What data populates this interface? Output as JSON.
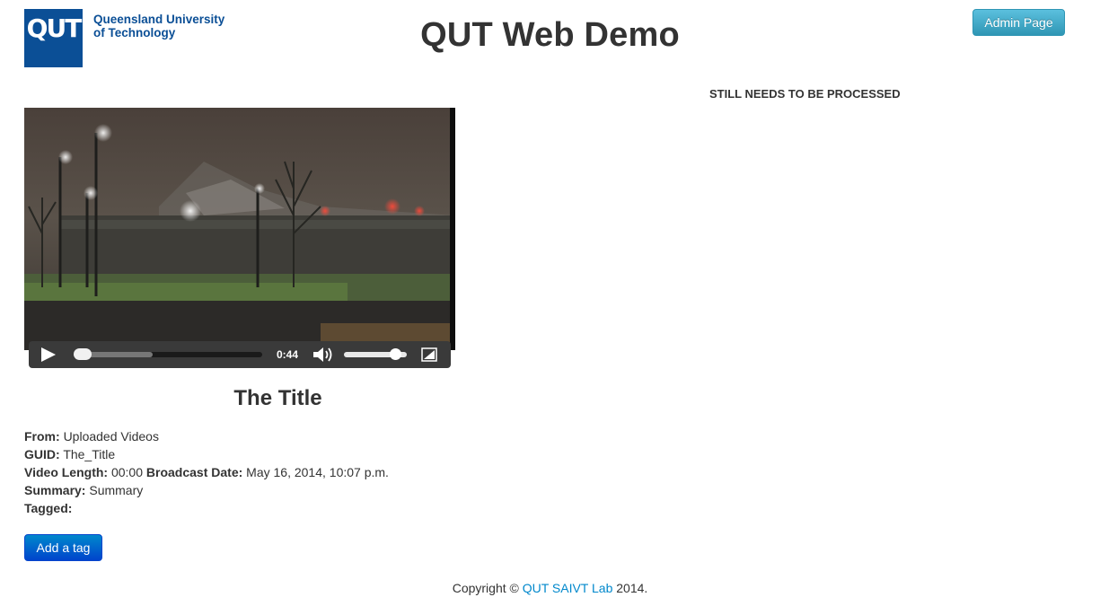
{
  "header": {
    "logo_mark": "QUT",
    "logo_line1": "Queensland University",
    "logo_line2": "of Technology",
    "title": "QUT Web Demo",
    "admin_label": "Admin Page"
  },
  "status_message": "STILL NEEDS TO BE PROCESSED",
  "player": {
    "time": "0:44",
    "progress_fraction": 0.02,
    "buffered_fraction": 0.42,
    "volume_fraction": 0.9
  },
  "video": {
    "title": "The Title",
    "from_label": "From:",
    "from_value": "Uploaded Videos",
    "guid_label": "GUID:",
    "guid_value": "The_Title",
    "length_label": "Video Length:",
    "length_value": "00:00",
    "broadcast_label": "Broadcast Date:",
    "broadcast_value": "May 16, 2014, 10:07 p.m.",
    "summary_label": "Summary:",
    "summary_value": "Summary",
    "tagged_label": "Tagged:"
  },
  "actions": {
    "add_tag_label": "Add a tag"
  },
  "footer": {
    "prefix": "Copyright ©",
    "link_text": "QUT SAIVT Lab",
    "suffix": "2014."
  },
  "colors": {
    "qut_blue": "#0b4f96",
    "admin_button": "#2f96b4",
    "primary_button": "#0044cc",
    "link": "#0088cc"
  }
}
